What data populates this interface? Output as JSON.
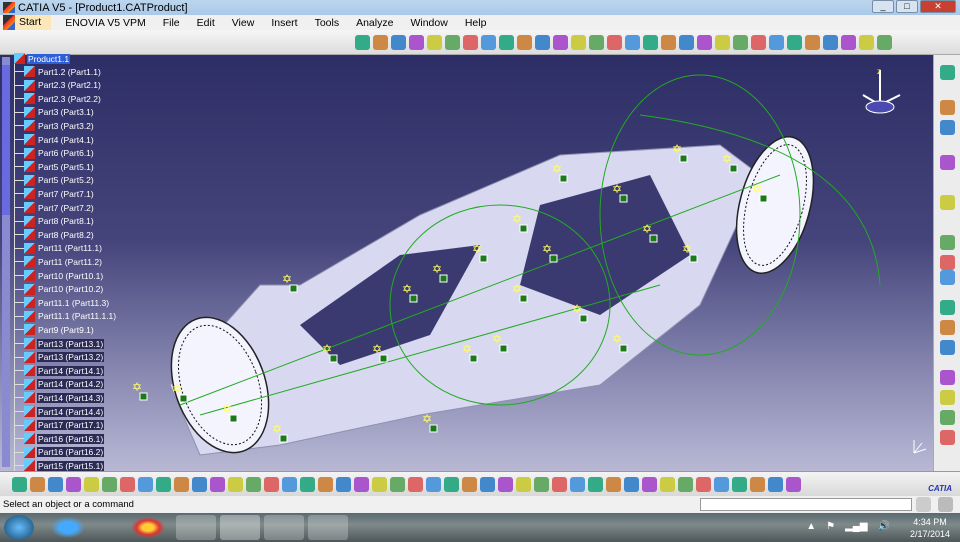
{
  "window": {
    "title": "CATIA V5 - [Product1.CATProduct]",
    "controls": [
      "_",
      "□",
      "✕"
    ]
  },
  "menu": {
    "start": "Start",
    "items": [
      "ENOVIA V5 VPM",
      "File",
      "Edit",
      "View",
      "Insert",
      "Tools",
      "Analyze",
      "Window",
      "Help"
    ]
  },
  "tree": {
    "root": "Product1.1",
    "items": [
      {
        "label": "Part1.2 (Part1.1)",
        "sel": false
      },
      {
        "label": "Part2.3 (Part2.1)",
        "sel": false
      },
      {
        "label": "Part2.3 (Part2.2)",
        "sel": false
      },
      {
        "label": "Part3 (Part3.1)",
        "sel": false
      },
      {
        "label": "Part3 (Part3.2)",
        "sel": false
      },
      {
        "label": "Part4 (Part4.1)",
        "sel": false
      },
      {
        "label": "Part6 (Part6.1)",
        "sel": false
      },
      {
        "label": "Part5 (Part5.1)",
        "sel": false
      },
      {
        "label": "Part5 (Part5.2)",
        "sel": false
      },
      {
        "label": "Part7 (Part7.1)",
        "sel": false
      },
      {
        "label": "Part7 (Part7.2)",
        "sel": false
      },
      {
        "label": "Part8 (Part8.1)",
        "sel": false
      },
      {
        "label": "Part8 (Part8.2)",
        "sel": false
      },
      {
        "label": "Part11 (Part11.1)",
        "sel": false
      },
      {
        "label": "Part11 (Part11.2)",
        "sel": false
      },
      {
        "label": "Part10 (Part10.1)",
        "sel": false
      },
      {
        "label": "Part10 (Part10.2)",
        "sel": false
      },
      {
        "label": "Part11.1 (Part11.3)",
        "sel": false
      },
      {
        "label": "Part11.1 (Part11.1.1)",
        "sel": false
      },
      {
        "label": "Part9 (Part9.1)",
        "sel": false
      },
      {
        "label": "Part13 (Part13.1)",
        "sel": true
      },
      {
        "label": "Part13 (Part13.2)",
        "sel": true
      },
      {
        "label": "Part14 (Part14.1)",
        "sel": true
      },
      {
        "label": "Part14 (Part14.2)",
        "sel": true
      },
      {
        "label": "Part14 (Part14.3)",
        "sel": true
      },
      {
        "label": "Part14 (Part14.4)",
        "sel": true
      },
      {
        "label": "Part17 (Part17.1)",
        "sel": true
      },
      {
        "label": "Part16 (Part16.1)",
        "sel": true
      },
      {
        "label": "Part16 (Part16.2)",
        "sel": true
      },
      {
        "label": "Part15 (Part15.1)",
        "sel": true
      }
    ]
  },
  "status": {
    "message": "Select an object or a command",
    "command_value": ""
  },
  "logo": "CATIA",
  "taskbar": {
    "time": "4:34 PM",
    "date": "2/17/2014"
  },
  "colors": {
    "accent": "#2d5fd8",
    "viewport_top": "#2e2e66",
    "viewport_bottom": "#b8b8d4",
    "constraint": "#22aa22"
  }
}
